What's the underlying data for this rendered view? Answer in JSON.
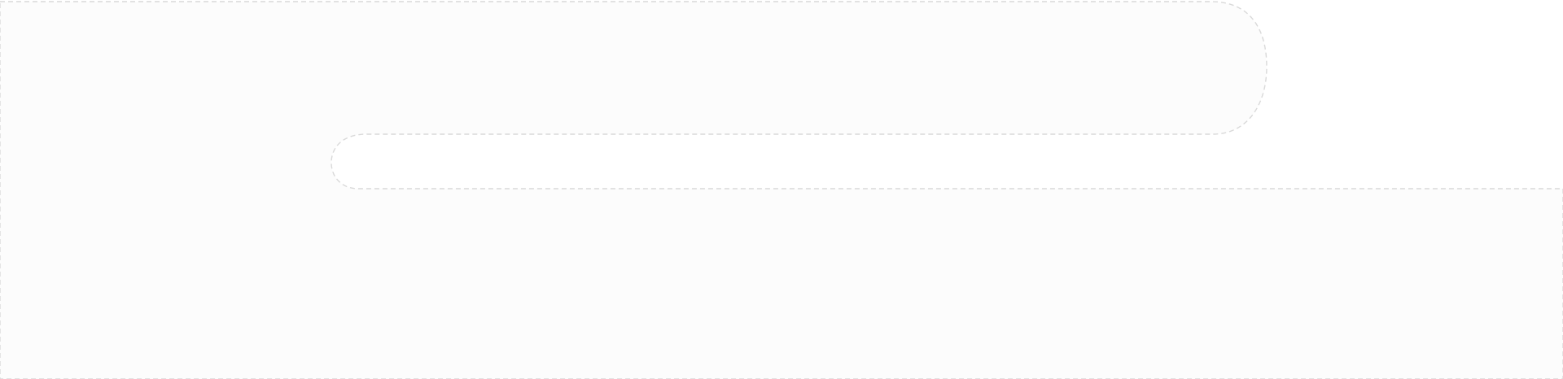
{
  "colors": {
    "page_background": "#ffffff",
    "panel_fill": "#fcfcfc",
    "dashed_outline": "#d9d9d9"
  }
}
